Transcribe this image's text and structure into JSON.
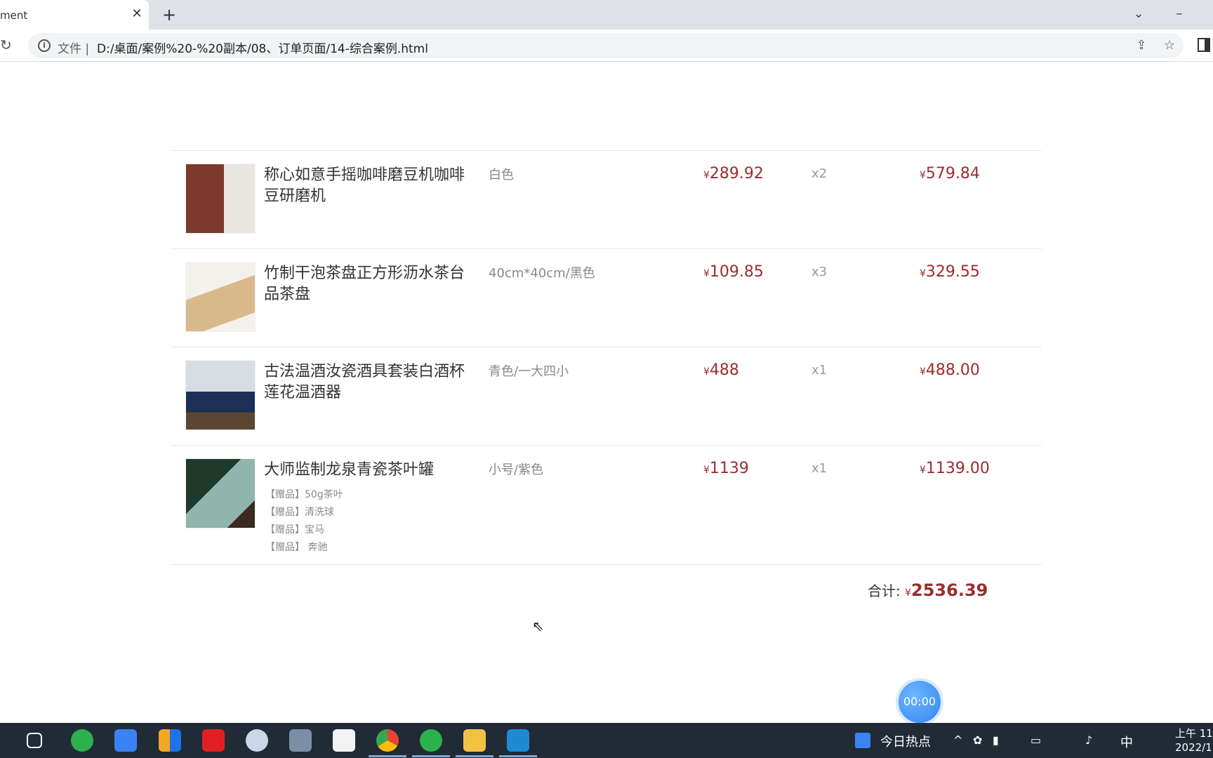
{
  "browser": {
    "tab_title": "ment",
    "close_glyph": "✕",
    "new_tab_glyph": "+",
    "file_label": "文件 |",
    "url": "D:/桌面/案例%20-%20副本/08、订单页面/14-综合案例.html",
    "icons": [
      "reload-icon",
      "info-icon",
      "share-icon",
      "star-icon",
      "side-panel-icon",
      "tab-list-icon",
      "minimize-icon"
    ]
  },
  "cart": {
    "currency": "¥",
    "items": [
      {
        "name": "称心如意手摇咖啡磨豆机咖啡豆研磨机",
        "spec": "白色",
        "price": "289.92",
        "qty": "x2",
        "total": "579.84",
        "gifts": []
      },
      {
        "name": "竹制干泡茶盘正方形沥水茶台品茶盘",
        "spec": "40cm*40cm/黑色",
        "price": "109.85",
        "qty": "x3",
        "total": "329.55",
        "gifts": []
      },
      {
        "name": "古法温酒汝瓷酒具套装白酒杯莲花温酒器",
        "spec": "青色/一大四小",
        "price": "488",
        "qty": "x1",
        "total": "488.00",
        "gifts": []
      },
      {
        "name": "大师监制龙泉青瓷茶叶罐",
        "spec": "小号/紫色",
        "price": "1139",
        "qty": "x1",
        "total": "1139.00",
        "gifts": [
          "【赠品】50g茶叶",
          "【赠品】清洗球",
          "【赠品】宝马",
          "【赠品】 奔驰"
        ]
      }
    ],
    "sum_label": "合计:",
    "sum_value": "2536.39",
    "price_color": "#9a2d2d"
  },
  "timer": "00:00",
  "taskbar": {
    "news_label": "今日热点",
    "ime_label": "中",
    "clock_time": "上午 11:",
    "clock_date": "2022/1"
  }
}
